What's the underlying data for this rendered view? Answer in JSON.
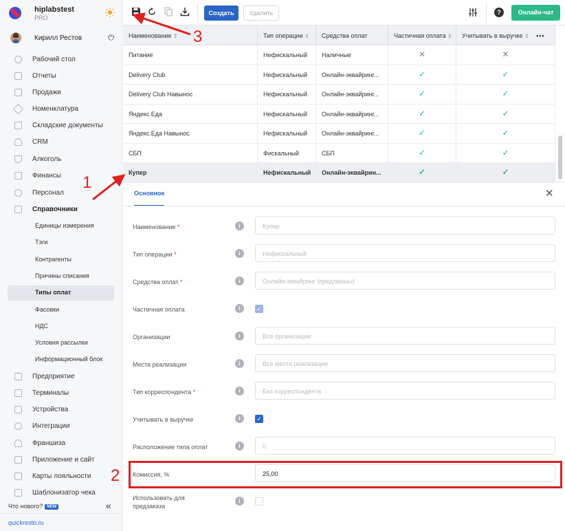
{
  "brand": {
    "name": "hiplabstest",
    "plan": "PRO"
  },
  "user": {
    "name": "Кирилл Рестов"
  },
  "sidebar": {
    "items": [
      {
        "label": "Рабочий стол",
        "icon": "dashboard-icon"
      },
      {
        "label": "Отчеты",
        "icon": "chart-icon"
      },
      {
        "label": "Продажи",
        "icon": "cart-icon"
      },
      {
        "label": "Номенклатура",
        "icon": "tag-icon"
      },
      {
        "label": "Складские документы",
        "icon": "box-icon"
      },
      {
        "label": "CRM",
        "icon": "people-icon"
      },
      {
        "label": "Алкоголь",
        "icon": "glass-icon"
      },
      {
        "label": "Финансы",
        "icon": "wallet-icon"
      },
      {
        "label": "Персонал",
        "icon": "staff-icon"
      },
      {
        "label": "Справочники",
        "icon": "book-icon"
      }
    ],
    "subitems": [
      {
        "label": "Единицы измерения"
      },
      {
        "label": "Тэги"
      },
      {
        "label": "Контрагенты"
      },
      {
        "label": "Причины списания"
      },
      {
        "label": "Типы оплат"
      },
      {
        "label": "Фасовки"
      },
      {
        "label": "НДС"
      },
      {
        "label": "Условия рассылки"
      },
      {
        "label": "Информационный блок"
      }
    ],
    "items2": [
      {
        "label": "Предприятие",
        "icon": "building-icon"
      },
      {
        "label": "Терминалы",
        "icon": "terminal-icon"
      },
      {
        "label": "Устройства",
        "icon": "printer-icon"
      },
      {
        "label": "Интеграции",
        "icon": "link-icon"
      },
      {
        "label": "Франшиза",
        "icon": "franchise-icon"
      },
      {
        "label": "Приложение и сайт",
        "icon": "monitor-icon"
      },
      {
        "label": "Карты лояльности",
        "icon": "card-icon"
      },
      {
        "label": "Шаблонизатор чека",
        "icon": "receipt-icon"
      }
    ],
    "whats_new": "Что нового?",
    "new_badge": "NEW",
    "site": "quickresto.ru"
  },
  "toolbar": {
    "create_label": "Создать",
    "delete_label": "Удалить",
    "chat_label": "Онлайн-чат"
  },
  "grid": {
    "columns": [
      "Наименование",
      "Тип операции",
      "Средства оплат",
      "Частичная оплата",
      "Учитывать в выручке"
    ],
    "rows": [
      {
        "name": "Питание",
        "op": "Нефискальный",
        "means": "Наличные",
        "partial": false,
        "revenue": false
      },
      {
        "name": "Delivery Club",
        "op": "Нефискальный",
        "means": "Онлайн-эквайринг...",
        "partial": true,
        "revenue": true
      },
      {
        "name": "Delivery Club Навынос",
        "op": "Нефискальный",
        "means": "Онлайн-эквайринг...",
        "partial": true,
        "revenue": true
      },
      {
        "name": "Яндекс.Еда",
        "op": "Нефискальный",
        "means": "Онлайн-эквайринг...",
        "partial": true,
        "revenue": true
      },
      {
        "name": "Яндекс.Еда Навынос",
        "op": "Нефискальный",
        "means": "Онлайн-эквайринг...",
        "partial": true,
        "revenue": true
      },
      {
        "name": "СБП",
        "op": "Фискальный",
        "means": "СБП",
        "partial": true,
        "revenue": true
      },
      {
        "name": "Купер",
        "op": "Нефискальный",
        "means": "Онлайн-эквайрин...",
        "partial": true,
        "revenue": true
      }
    ]
  },
  "panel": {
    "tab": "Основное",
    "fields": {
      "name": {
        "label": "Наименование",
        "value": "Купер"
      },
      "op_type": {
        "label": "Тип операции",
        "value": "Нефискальный"
      },
      "means": {
        "label": "Средства оплат",
        "value": "Онлайн-эквайринг (предзаказы)"
      },
      "partial": {
        "label": "Частичная оплата",
        "checked": true
      },
      "orgs": {
        "label": "Организации",
        "value": "Все организации"
      },
      "places": {
        "label": "Места реализации",
        "value": "Все места реализации"
      },
      "corr": {
        "label": "Тип корреспондента",
        "value": "Без корреспондента"
      },
      "revenue": {
        "label": "Учитывать в выручке",
        "checked": true
      },
      "position": {
        "label": "Расположение типа оплат",
        "value": "0"
      },
      "commission": {
        "label": "Комиссия, %",
        "value": "25,00"
      },
      "preorder": {
        "label_line1": "Использовать для",
        "label_line2": "предзаказа",
        "checked": false
      }
    }
  },
  "annotations": [
    "1",
    "2",
    "3"
  ]
}
